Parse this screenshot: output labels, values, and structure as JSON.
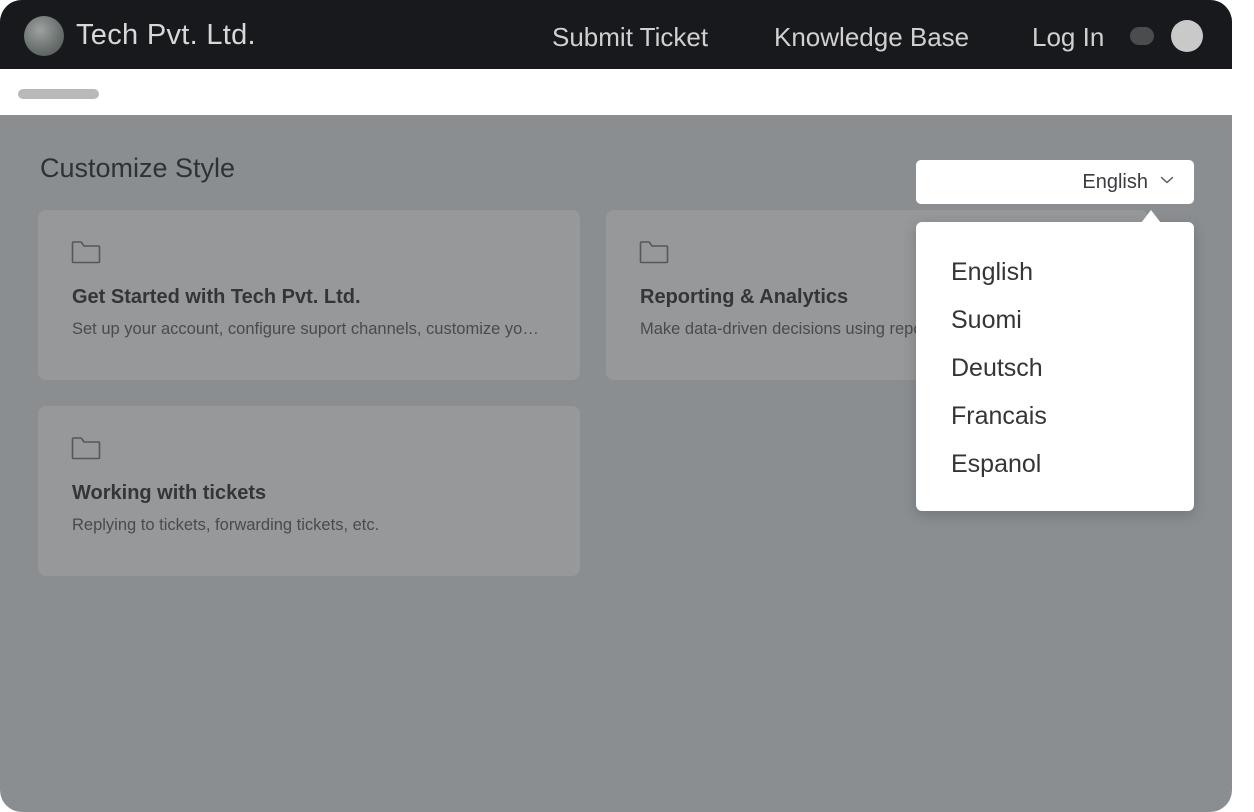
{
  "header": {
    "brand": "Tech Pvt. Ltd.",
    "nav": {
      "submit_ticket": "Submit Ticket",
      "knowledge_base": "Knowledge Base",
      "log_in": "Log In"
    }
  },
  "main": {
    "title": "Customize Style",
    "cards": [
      {
        "title": "Get Started with Tech Pvt. Ltd.",
        "description": "Set up your account, configure suport channels, customize your help center",
        "icon": "folder-icon"
      },
      {
        "title": "Reporting & Analytics",
        "description": "Make data-driven decisions using reports and analytics",
        "icon": "folder-icon"
      },
      {
        "title": "Working with tickets",
        "description": "Replying to tickets, forwarding tickets, etc.",
        "icon": "folder-icon"
      }
    ]
  },
  "language": {
    "selected": "English",
    "options": [
      "English",
      "Suomi",
      "Deutsch",
      "Francais",
      "Espanol"
    ]
  },
  "colors": {
    "topbar": "#18191c",
    "overlay_background": "#8b8e91",
    "card_background": "#979899"
  }
}
